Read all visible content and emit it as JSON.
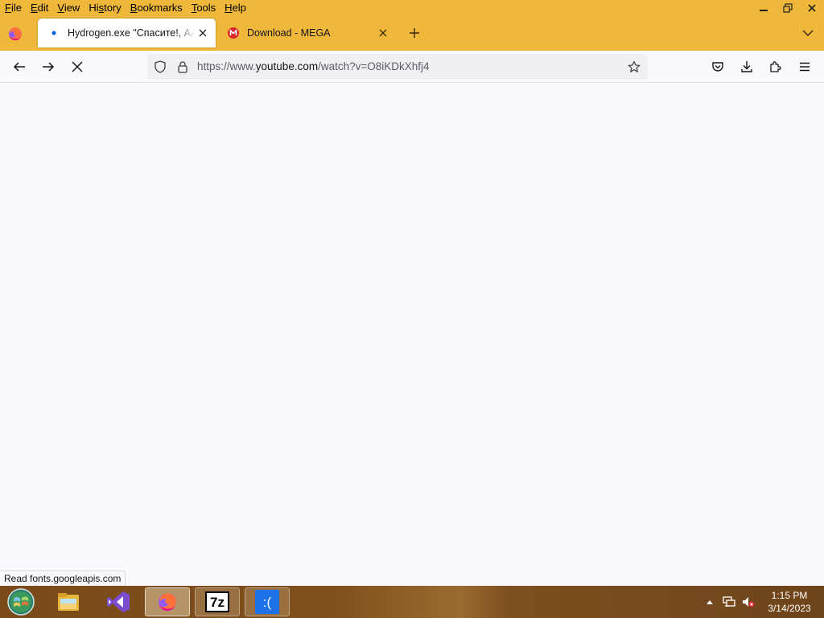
{
  "menubar": {
    "items": [
      {
        "acc": "F",
        "rest": "ile"
      },
      {
        "acc": "E",
        "rest": "dit"
      },
      {
        "acc": "V",
        "rest": "iew"
      },
      {
        "pre": "Hi",
        "acc": "s",
        "rest": "tory"
      },
      {
        "acc": "B",
        "rest": "ookmarks"
      },
      {
        "acc": "T",
        "rest": "ools"
      },
      {
        "acc": "H",
        "rest": "elp"
      }
    ]
  },
  "tabs": [
    {
      "title": "Hydrogen.exe \"Спасите!, АААААААААА",
      "icon": "loading-dot-icon",
      "active": true
    },
    {
      "title": "Download - MEGA",
      "icon": "mega-icon",
      "active": false
    }
  ],
  "urlbar": {
    "prefix": "https://www.",
    "domain": "youtube.com",
    "path": "/watch?v=O8iKDkXhfj4"
  },
  "status": {
    "text": "Read fonts.googleapis.com"
  },
  "taskbar": {
    "apps": [
      {
        "name": "file-explorer-icon"
      },
      {
        "name": "visual-studio-icon"
      },
      {
        "name": "firefox-icon"
      },
      {
        "name": "7zip-icon",
        "label": "7z"
      },
      {
        "name": "bsod-app-icon",
        "label": ":("
      }
    ],
    "clock": {
      "time": "1:15 PM",
      "date": "3/14/2023"
    }
  },
  "colors": {
    "tab_strip": "#efb83a",
    "toolbar": "#f9f9fb",
    "mega_red": "#d9272e",
    "loading_blue": "#0060df"
  }
}
